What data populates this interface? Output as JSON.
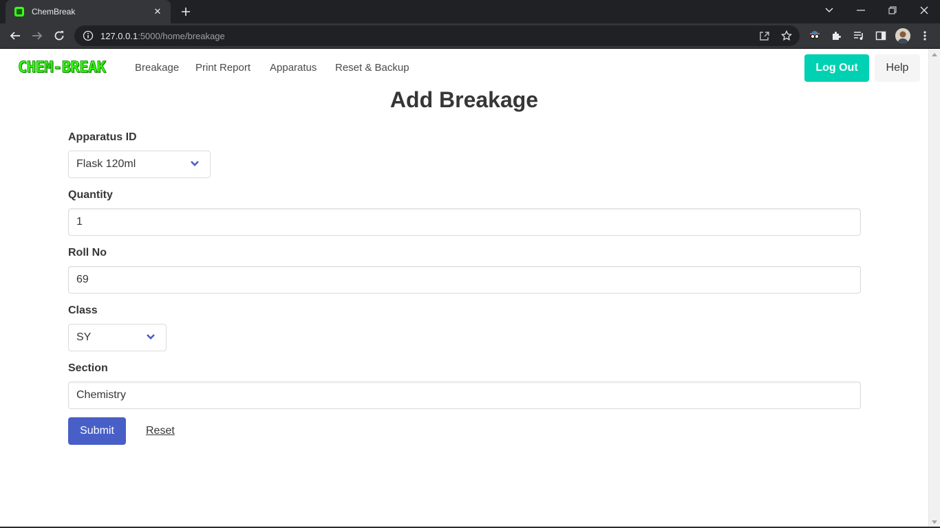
{
  "browser": {
    "tab_title": "ChemBreak",
    "url_host": "127.0.0.1",
    "url_rest": ":5000/home/breakage"
  },
  "nav": {
    "logo": "CHEM-BREAK",
    "links": [
      "Breakage",
      "Print Report",
      "Apparatus",
      "Reset & Backup"
    ],
    "logout_label": "Log Out",
    "help_label": "Help"
  },
  "form": {
    "title": "Add Breakage",
    "apparatus_label": "Apparatus ID",
    "apparatus_value": "Flask 120ml",
    "quantity_label": "Quantity",
    "quantity_value": "1",
    "rollno_label": "Roll No",
    "rollno_value": "69",
    "class_label": "Class",
    "class_value": "SY",
    "section_label": "Section",
    "section_value": "Chemistry",
    "submit_label": "Submit",
    "reset_label": "Reset"
  },
  "colors": {
    "logout_bg": "#00d1b2",
    "submit_bg": "#485fc7",
    "logo_green": "#39ff14",
    "chevron": "#485fc7"
  }
}
